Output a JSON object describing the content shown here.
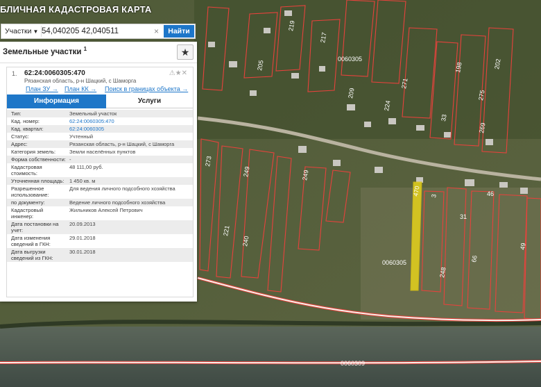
{
  "app": {
    "title": "БЛИЧНАЯ КАДАСТРОВАЯ КАРТА"
  },
  "search": {
    "type_label": "Участки",
    "query": "54,040205 42,040511",
    "clear_label": "×",
    "button_label": "Найти"
  },
  "panel": {
    "title": "Земельные участки",
    "title_sup": "1",
    "star_label": "★",
    "card": {
      "index": "1.",
      "cad_number": "62:24:0060305:470",
      "address": "Рязанская область, р-н Шацкий, с Шаморга",
      "links": [
        "План ЗУ →",
        "План КК →",
        "Поиск в границах объекта →"
      ],
      "tabs": [
        "Информация",
        "Услуги"
      ],
      "rows": [
        {
          "key": "Тип:",
          "value": "Земельный участок"
        },
        {
          "key": "Кад. номер:",
          "value": "62:24:0060305:470"
        },
        {
          "key": "Кад. квартал:",
          "value": "62:24:0060305"
        },
        {
          "key": "Статус:",
          "value": "Учтенный"
        },
        {
          "key": "Адрес:",
          "value": "Рязанская область, р-н Шацкий, с Шаморга"
        },
        {
          "key": "Категория земель:",
          "value": "Земли населённых пунктов"
        },
        {
          "key": "Форма собственности:",
          "value": "-"
        },
        {
          "key": "Кадастровая стоимость:",
          "value": "48 111,00 руб."
        },
        {
          "key": "Уточненная площадь:",
          "value": "1 450 кв. м"
        },
        {
          "key": "Разрешенное использование:",
          "value": "Для ведения личного подсобного хозяйства"
        },
        {
          "key": "по документу:",
          "value": "Ведение личного подсобного хозяйства"
        },
        {
          "key": "Кадастровый инженер:",
          "value": "Жильников Алексей Петрович"
        },
        {
          "key": "Дата постановки на учет:",
          "value": "20.09.2013"
        },
        {
          "key": "Дата изменения сведений в ГКН:",
          "value": "29.01.2018"
        },
        {
          "key": "Дата выгрузки сведений из ГКН:",
          "value": "30.01.2018"
        }
      ]
    }
  },
  "map": {
    "quarter_labels": [
      "0060305",
      "0060305",
      "0060309"
    ],
    "parcel_labels": [
      "205",
      "219",
      "217",
      "209",
      "271",
      "224",
      "273",
      "221",
      "249",
      "240",
      "249",
      "198",
      "33",
      "275",
      "269",
      "248",
      "66",
      "31",
      "470",
      "46",
      "49",
      "3",
      "202"
    ],
    "colors": {
      "highlight": "#e5d21c",
      "boundary": "#e8423c",
      "accent": "#1d76c9"
    }
  }
}
